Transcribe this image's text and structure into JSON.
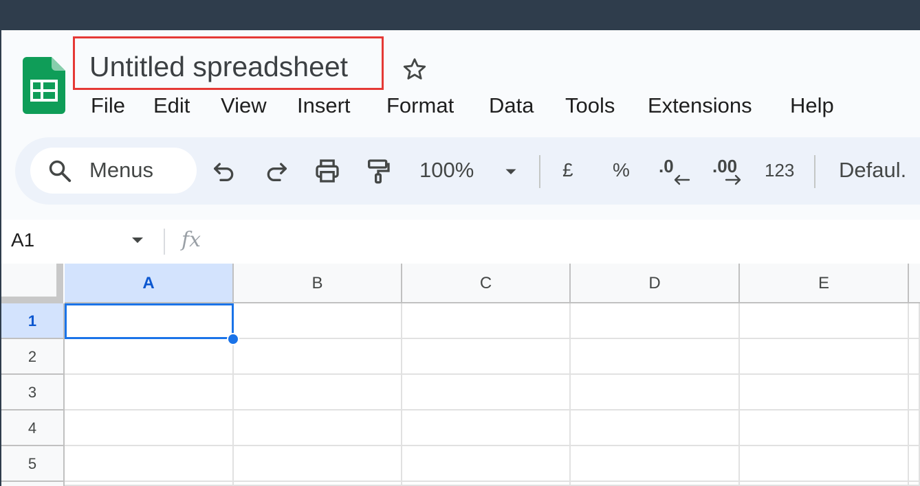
{
  "document": {
    "title": "Untitled spreadsheet"
  },
  "menu": {
    "items": [
      "File",
      "Edit",
      "View",
      "Insert",
      "Format",
      "Data",
      "Tools",
      "Extensions",
      "Help"
    ]
  },
  "toolbar": {
    "search_label": "Menus",
    "zoom": "100%",
    "currency": "£",
    "percent": "%",
    "decrease_decimal": ".0",
    "increase_decimal": ".00",
    "number_format": "123",
    "font": "Defaul."
  },
  "formula_bar": {
    "cell_ref": "A1",
    "fx": "fx"
  },
  "grid": {
    "columns": [
      "A",
      "B",
      "C",
      "D",
      "E"
    ],
    "rows": [
      "1",
      "2",
      "3",
      "4",
      "5"
    ],
    "selected_column": "A",
    "selected_row": "1"
  },
  "colors": {
    "title_highlight": "#e53935",
    "selection": "#1a73e8",
    "sheets_green": "#0f9d58"
  },
  "icons": [
    "sheets-logo-icon",
    "star-icon",
    "search-icon",
    "undo-icon",
    "redo-icon",
    "print-icon",
    "paint-format-icon",
    "chevron-down-icon"
  ]
}
